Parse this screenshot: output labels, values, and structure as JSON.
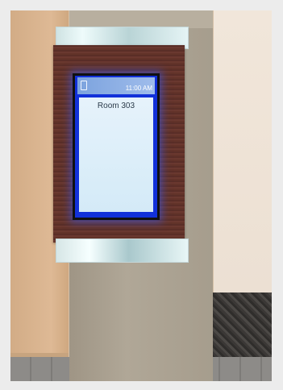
{
  "scene": {
    "subject": "digital room sign kiosk",
    "colors": {
      "frame": "#5f3129",
      "screen_border": "#1231d9",
      "screen_body": "#dff0fa",
      "pillar": "#a89f8f"
    }
  },
  "sign": {
    "header": {
      "logo_text": "",
      "date": "",
      "time": "11:00 AM"
    },
    "room_label": "Room 303"
  }
}
